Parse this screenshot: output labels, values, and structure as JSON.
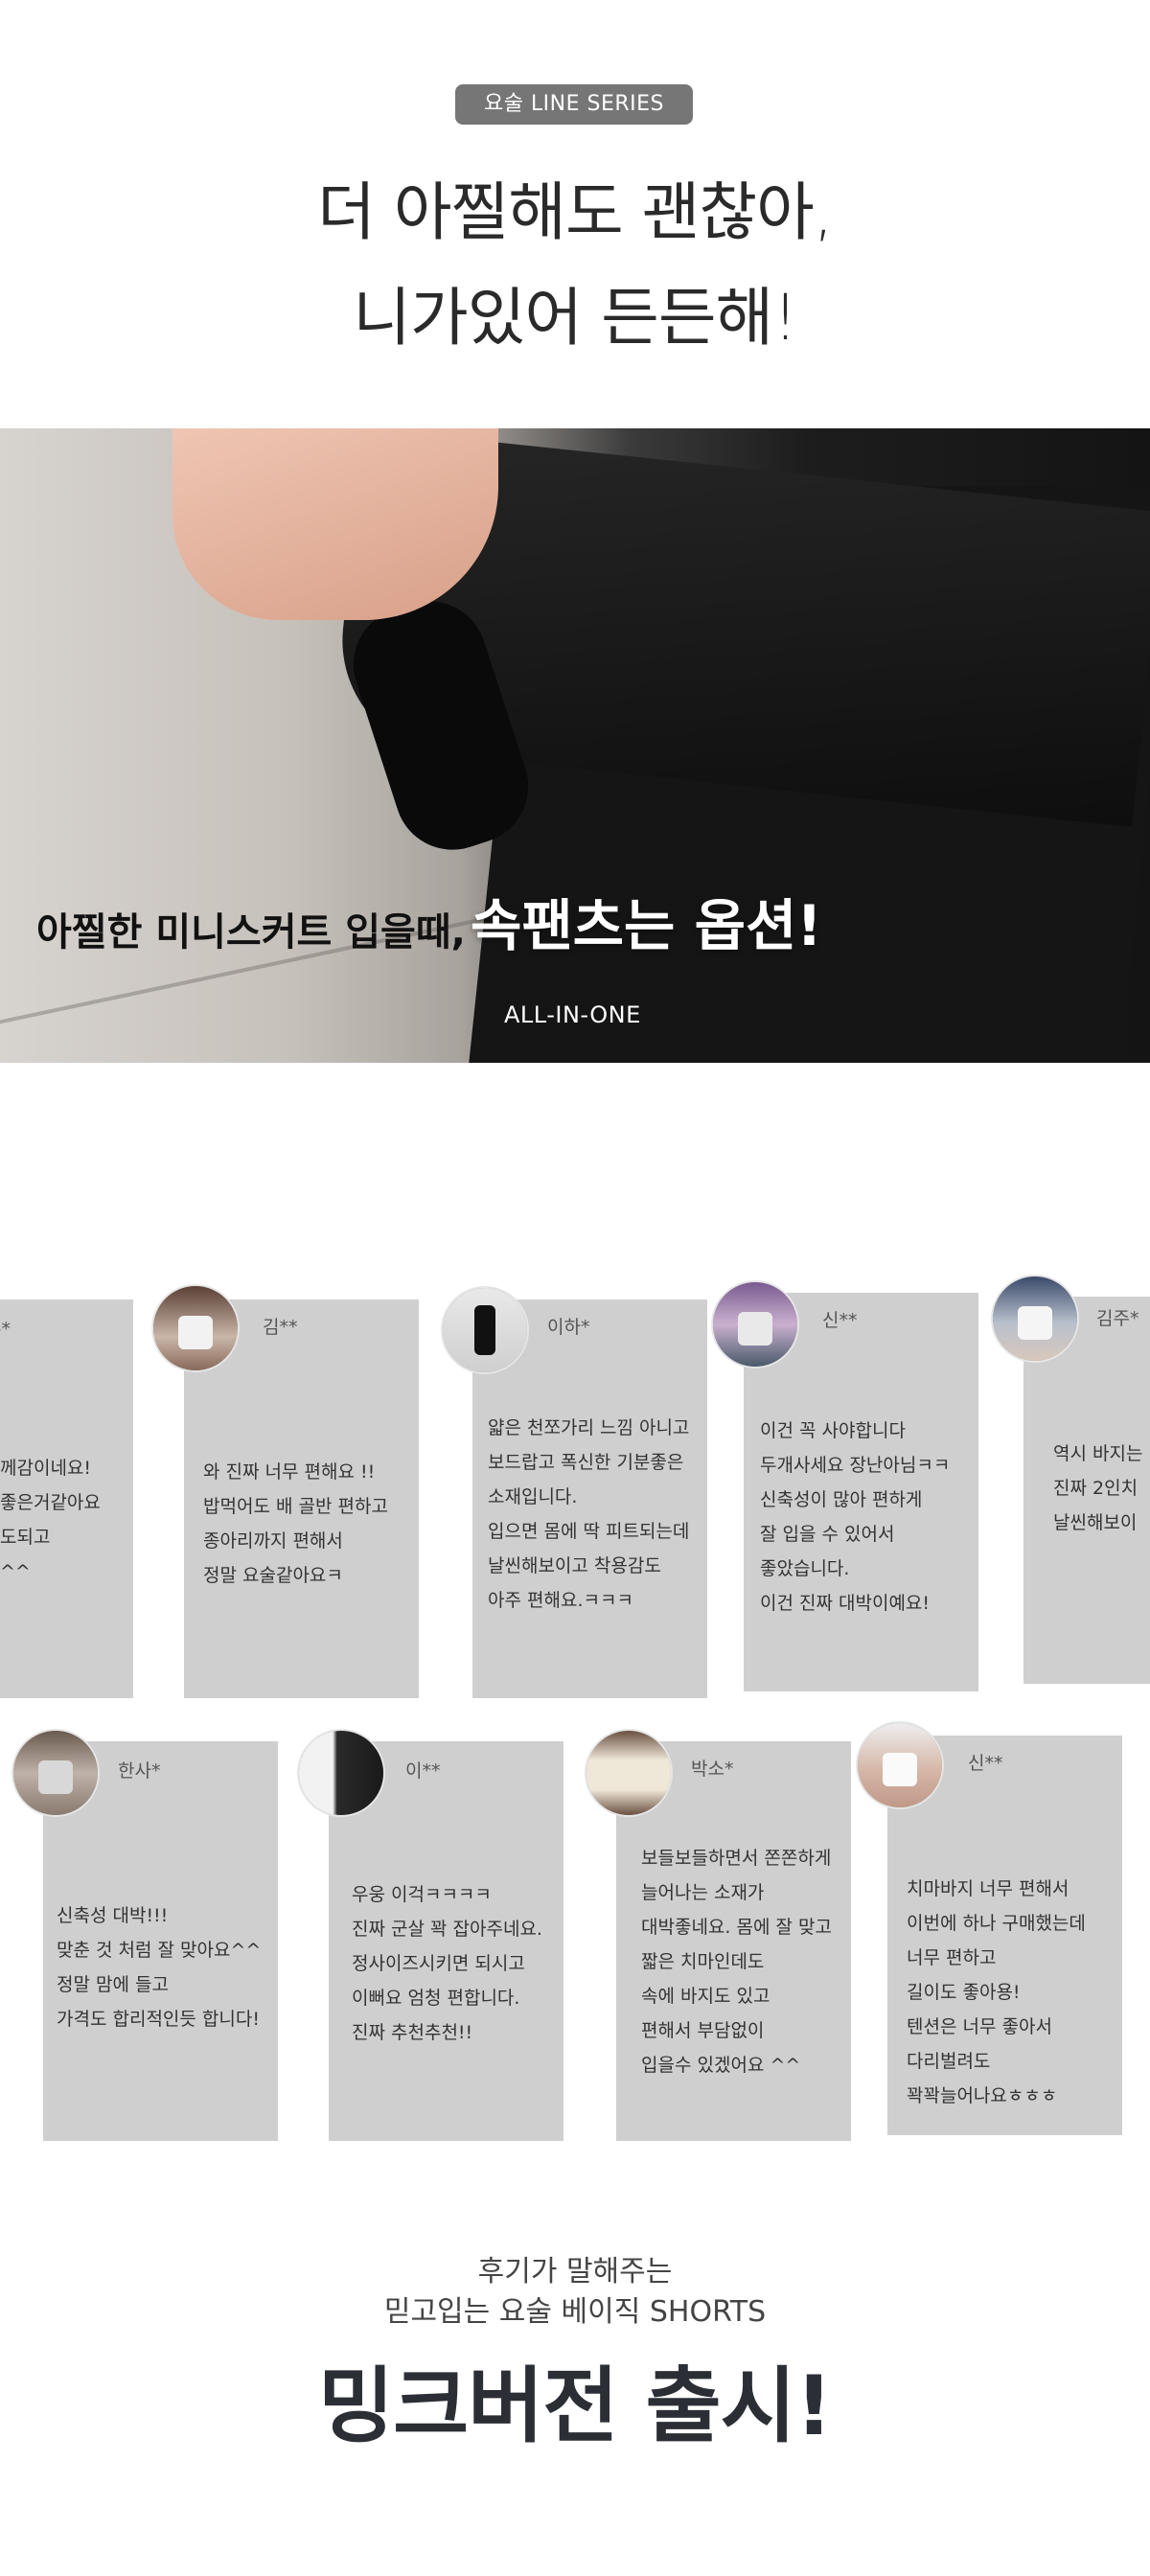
{
  "header": {
    "badge": "요술 LINE SERIES",
    "headline_line1": "더 아찔해도 괜찮아,",
    "headline_line2": "니가있어 든든해!"
  },
  "hero": {
    "caption_small": "아찔한 미니스커트 입을때,",
    "caption_big": "속팬츠는 옵션!",
    "sub": "ALL-IN-ONE"
  },
  "reviews_row1": [
    {
      "name": "주*",
      "text": "께감이네요!\n좋은거같아요\n도되고\n^^"
    },
    {
      "name": "김**",
      "text": "와 진짜 너무 편해요 !!\n밥먹어도 배 골반 편하고\n종아리까지 편해서\n정말 요술같아요ㅋ"
    },
    {
      "name": "이하*",
      "text": "얇은 천쪼가리 느낌 아니고\n보드랍고 폭신한 기분좋은\n소재입니다.\n입으면 몸에 딱 피트되는데\n날씬해보이고 착용감도\n아주 편해요.ㅋㅋㅋ"
    },
    {
      "name": "신**",
      "text": "이건 꼭 사야합니다\n두개사세요 장난아님ㅋㅋ\n신축성이 많아 편하게\n잘 입을 수 있어서\n좋았습니다.\n이건 진짜 대박이예요!"
    },
    {
      "name": "김주*",
      "text": "역시 바지는\n진짜 2인치\n날씬해보이"
    }
  ],
  "reviews_row2": [
    {
      "name": "한사*",
      "text": "신축성 대박!!!\n맞춘 것 처럼 잘 맞아요^^\n정말 맘에 들고\n가격도 합리적인듯 합니다!"
    },
    {
      "name": "이**",
      "text": "우웅 이걱ㅋㅋㅋㅋ\n진짜 군살 꽉 잡아주네요.\n정사이즈시키면 되시고\n이뻐요 엄청 편합니다.\n진짜 추천추천!!"
    },
    {
      "name": "박소*",
      "text": "보들보들하면서 쫀쫀하게\n늘어나는 소재가\n대박좋네요. 몸에 잘 맞고\n짧은 치마인데도\n속에 바지도 있고\n편해서 부담없이\n입을수 있겠어요 ^^"
    },
    {
      "name": "신**",
      "text": "치마바지 너무 편해서\n이번에 하나 구매했는데\n너무 편하고\n길이도 좋아용!\n텐션은 너무 좋아서\n다리벌려도\n꽉꽉늘어나요ㅎㅎㅎ"
    }
  ],
  "footer": {
    "sub_line1": "후기가 말해주는",
    "sub_line2": "믿고입는 요술 베이직 SHORTS",
    "title": "밍크버전 출시!"
  },
  "colors": {
    "card_bg": "#cfcfcf",
    "badge_bg": "#767676",
    "title_color": "#2b2f35"
  }
}
